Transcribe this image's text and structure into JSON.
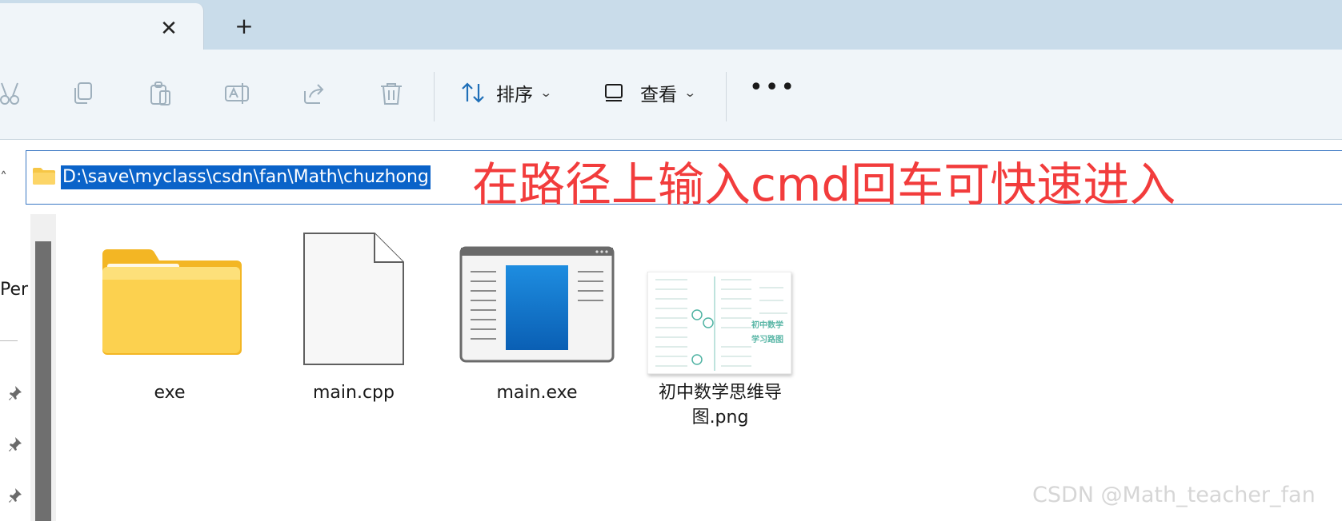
{
  "tabs": {
    "close_icon": "close-icon",
    "add_icon": "plus-icon"
  },
  "toolbar": {
    "icons": [
      "cut-icon",
      "copy-icon",
      "paste-icon",
      "rename-icon",
      "share-icon",
      "delete-icon"
    ],
    "sort_label": "排序",
    "view_label": "查看",
    "more_label": "•••"
  },
  "address": {
    "path": "D:\\save\\myclass\\csdn\\fan\\Math\\chuzhong",
    "annotation": "在路径上输入cmd回车可快速进入"
  },
  "nav": {
    "partial_item": "Pers"
  },
  "files": [
    {
      "name": "exe",
      "type": "folder"
    },
    {
      "name": "main.cpp",
      "type": "document"
    },
    {
      "name": "main.exe",
      "type": "application"
    },
    {
      "name_line1": "初中数学思维导",
      "name_line2": "图.png",
      "type": "image",
      "thumb_text1": "初中数学",
      "thumb_text2": "学习路图"
    }
  ],
  "watermark": "CSDN @Math_teacher_fan",
  "colors": {
    "tab_strip": "#c9dcea",
    "command_bar": "#f0f5f9",
    "selection": "#0a63c9",
    "annotation": "#f23c3c"
  }
}
